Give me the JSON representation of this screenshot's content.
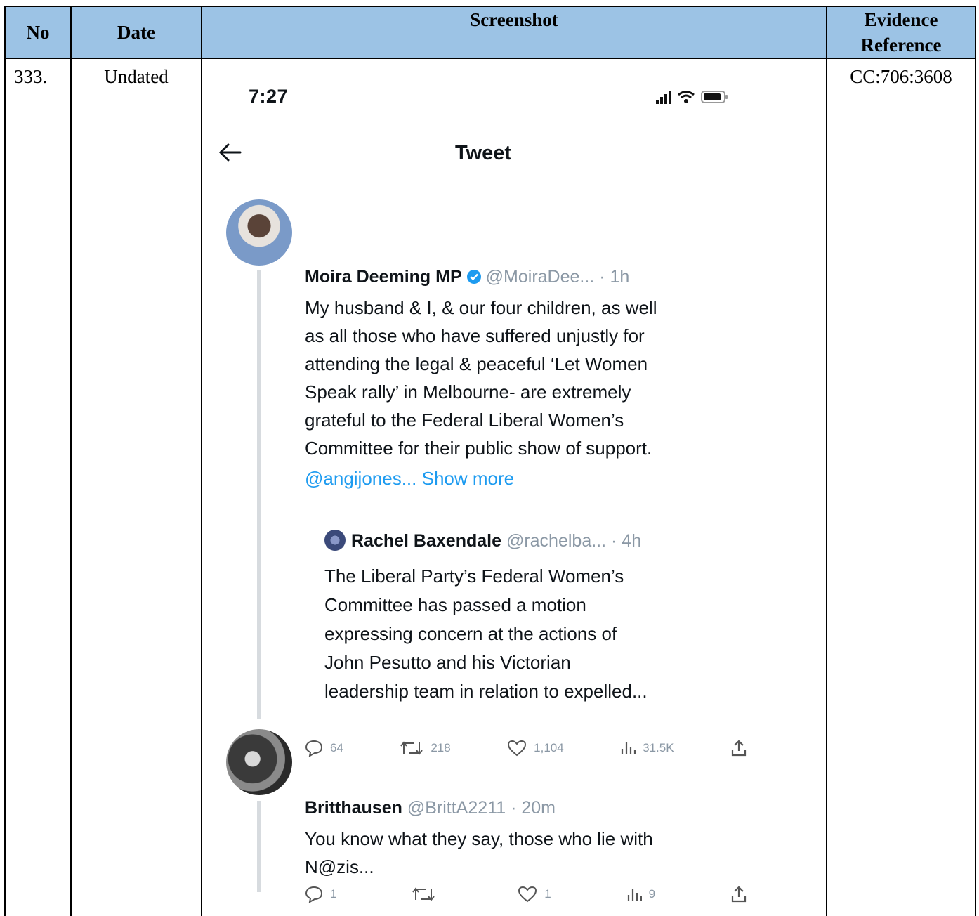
{
  "table": {
    "headers": {
      "no": "No",
      "date": "Date",
      "screenshot": "Screenshot",
      "evidence": "Evidence Reference"
    },
    "row": {
      "no": "333.",
      "date": "Undated",
      "evidence": "CC:706:3608"
    }
  },
  "phone": {
    "status": {
      "time": "7:27"
    },
    "header": {
      "title": "Tweet"
    },
    "tweet": {
      "name": "Moira Deeming MP",
      "handle": "@MoiraDee...",
      "age": "· 1h",
      "lines": [
        "My husband & I, & our four children, as well",
        "as all those who have suffered unjustly for",
        "attending the legal & peaceful ‘Let Women",
        "Speak rally’ in Melbourne- are extremely",
        "grateful to the Federal Liberal Women’s",
        "Committee for their public show of support."
      ],
      "mention": "@angijones...",
      "show_more": "Show more",
      "quote": {
        "name": "Rachel Baxendale",
        "handle": "@rachelba...",
        "age": "· 4h",
        "lines": [
          "The Liberal Party’s Federal Women’s",
          "Committee has passed a motion",
          "expressing concern at the actions of",
          "John Pesutto and his Victorian",
          "leadership team in relation to expelled..."
        ]
      },
      "actions": {
        "replies": "64",
        "retweets": "218",
        "likes": "1,104",
        "views": "31.5K"
      }
    },
    "reply": {
      "name": "Britthausen",
      "handle": "@BrittA2211",
      "age": "· 20m",
      "lines": [
        "You know what they say, those who lie with",
        "N@zis..."
      ],
      "actions": {
        "replies": "1",
        "retweets": "",
        "likes": "1",
        "views": "9"
      }
    }
  }
}
